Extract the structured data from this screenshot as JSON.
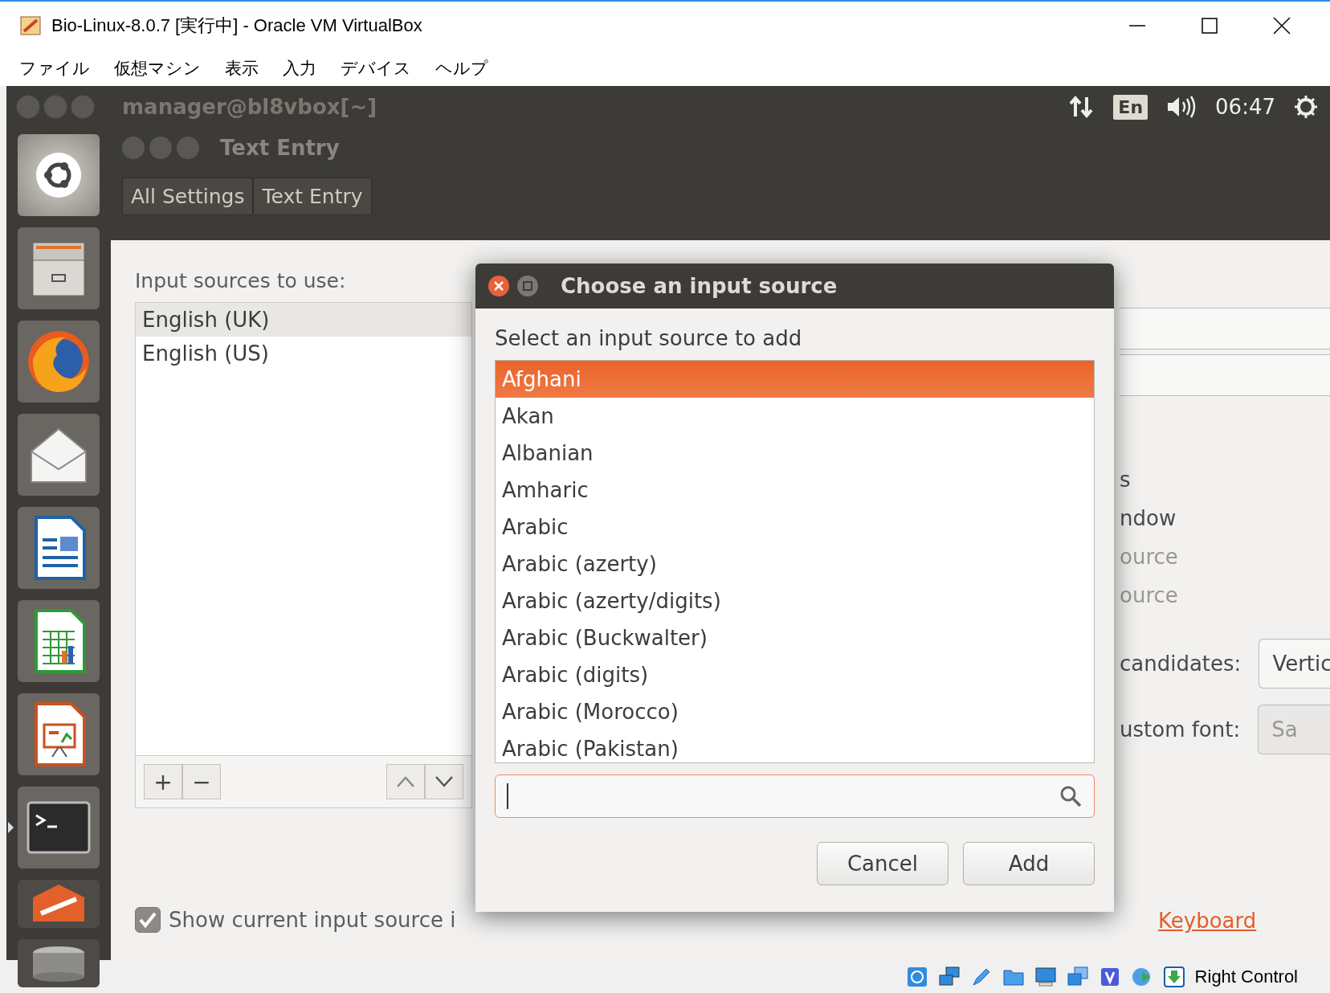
{
  "window": {
    "title": "Bio-Linux-8.0.7 [実行中] - Oracle VM VirtualBox"
  },
  "menu": [
    "ファイル",
    "仮想マシン",
    "表示",
    "入力",
    "デバイス",
    "ヘルプ"
  ],
  "top_panel": {
    "title": "manager@bl8vbox[~]",
    "keyboard": "En",
    "time": "06:47"
  },
  "settings_window": {
    "title": "Text Entry",
    "breadcrumbs": [
      "All Settings",
      "Text Entry"
    ]
  },
  "input_sources": {
    "label": "Input sources to use:",
    "items": [
      {
        "label": "English (UK)",
        "selected": true
      },
      {
        "label": "English (US)",
        "selected": false
      }
    ],
    "add_remove": [
      "+",
      "−"
    ]
  },
  "show_current": {
    "label": "Show current input source i",
    "checked": true
  },
  "right_panel": {
    "lines": [
      {
        "text": "s",
        "disabled": false
      },
      {
        "text": "ndow",
        "disabled": false
      },
      {
        "text": "ource",
        "disabled": true
      },
      {
        "text": "ource",
        "disabled": true
      }
    ],
    "candidates": {
      "label": "candidates:",
      "value": "Vertic"
    },
    "custom_font": {
      "label": "ustom font:",
      "value": "Sa",
      "disabled": true
    },
    "link": "Keyboard"
  },
  "dialog": {
    "title": "Choose an input source",
    "prompt": "Select an input source to add",
    "items": [
      {
        "label": "Afghani",
        "selected": true
      },
      {
        "label": "Akan",
        "selected": false
      },
      {
        "label": "Albanian",
        "selected": false
      },
      {
        "label": "Amharic",
        "selected": false
      },
      {
        "label": "Arabic",
        "selected": false
      },
      {
        "label": "Arabic (azerty)",
        "selected": false
      },
      {
        "label": "Arabic (azerty/digits)",
        "selected": false
      },
      {
        "label": "Arabic (Buckwalter)",
        "selected": false
      },
      {
        "label": "Arabic (digits)",
        "selected": false
      },
      {
        "label": "Arabic (Morocco)",
        "selected": false
      },
      {
        "label": "Arabic (Pakistan)",
        "selected": false
      }
    ],
    "buttons": [
      "Cancel",
      "Add"
    ]
  },
  "status_bar": {
    "host_key": "Right Control"
  }
}
